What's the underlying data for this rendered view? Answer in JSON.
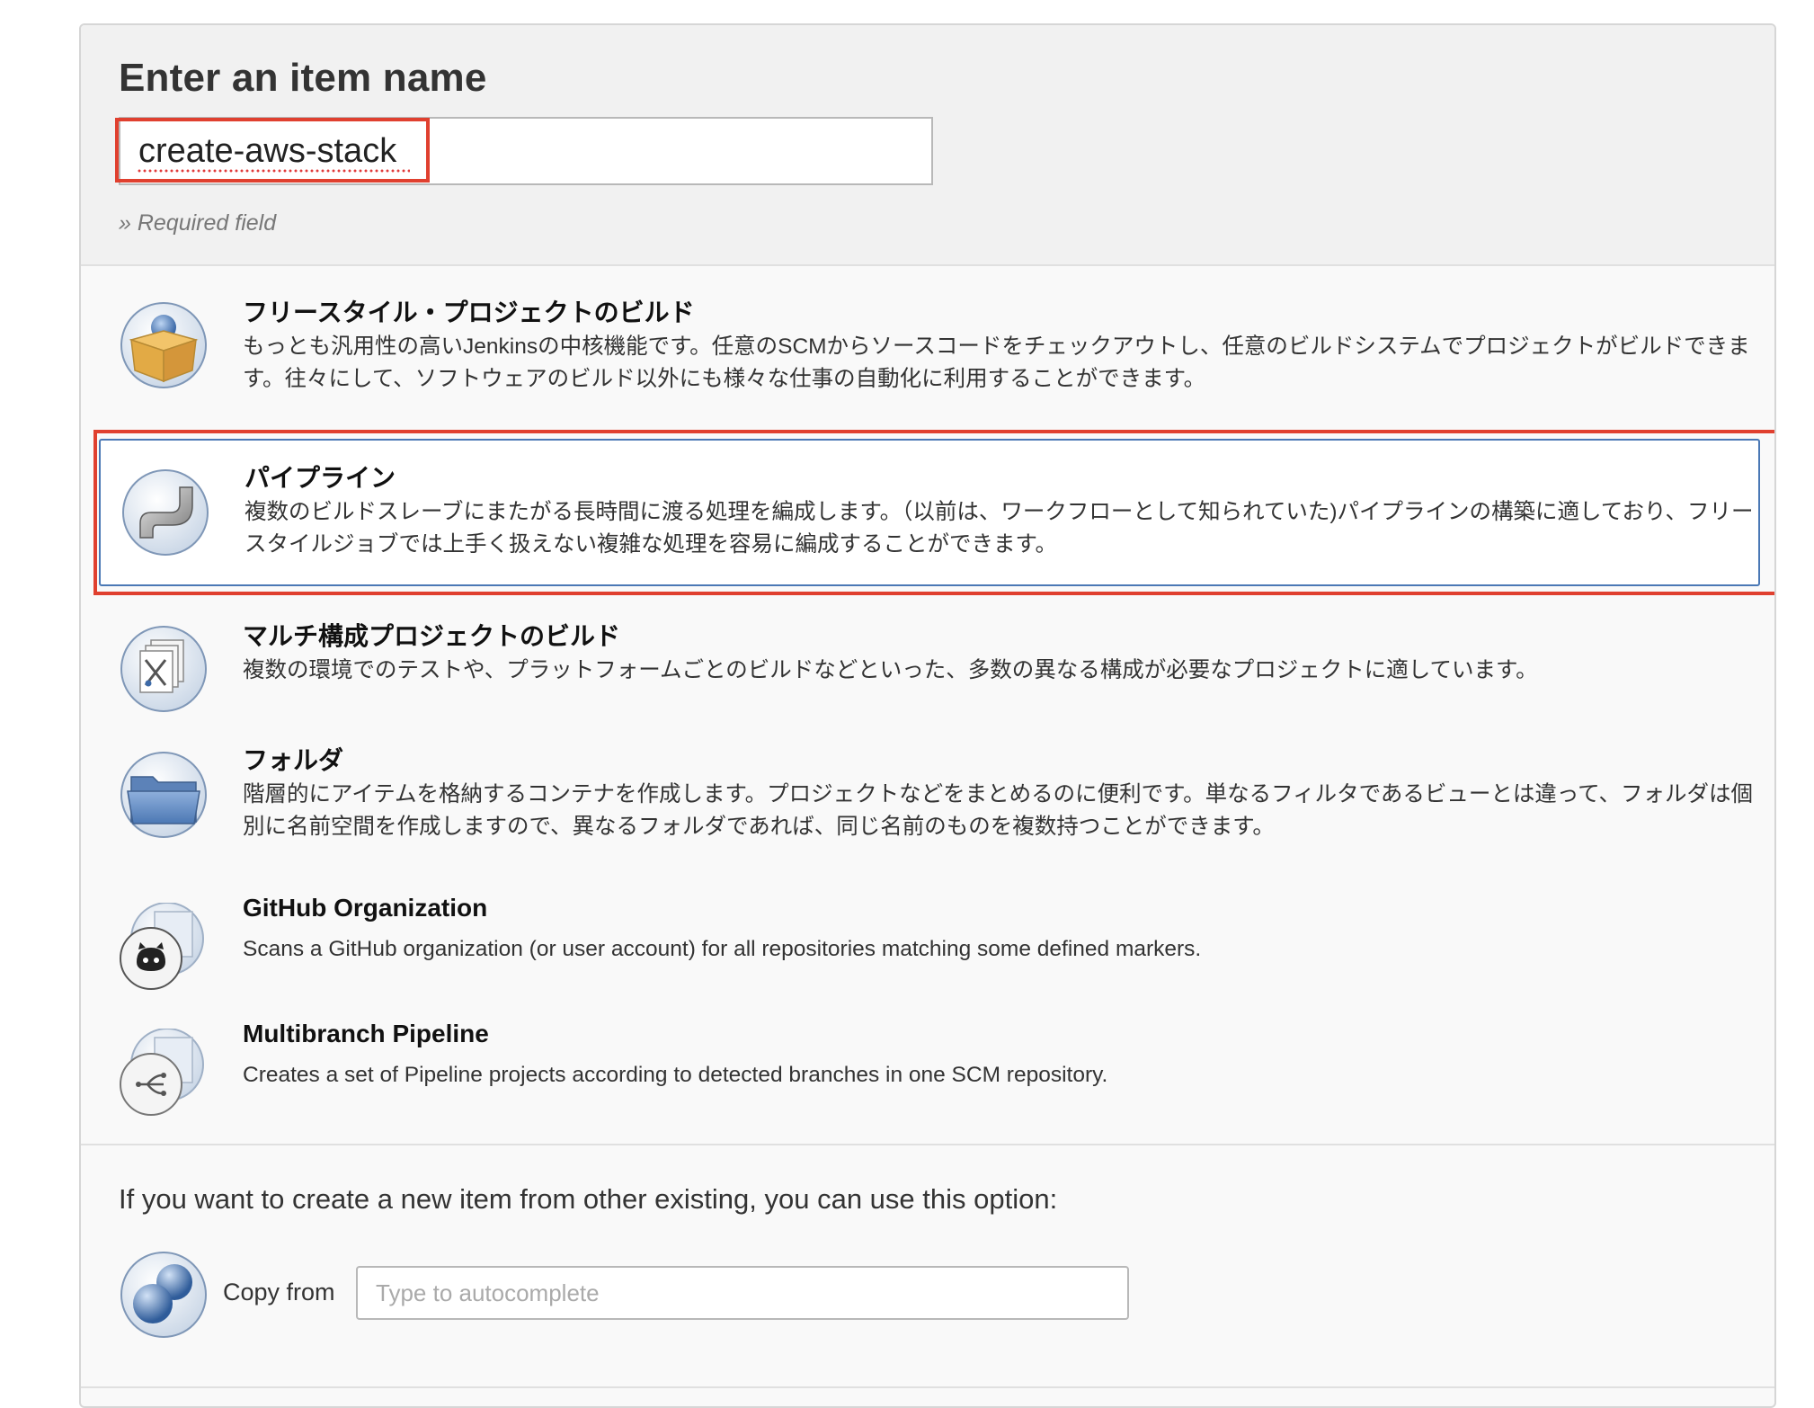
{
  "header": {
    "title": "Enter an item name",
    "name_value": "create-aws-stack",
    "required_note": "» Required field"
  },
  "items": [
    {
      "title": "フリースタイル・プロジェクトのビルド",
      "description": "もっとも汎用性の高いJenkinsの中核機能です。任意のSCMからソースコードをチェックアウトし、任意のビルドシステムでプロジェクトがビルドできます。往々にして、ソフトウェアのビルド以外にも様々な仕事の自動化に利用することができます。",
      "icon": "freestyle-box-icon"
    },
    {
      "title": "パイプライン",
      "description": "複数のビルドスレーブにまたがる長時間に渡る処理を編成します。（以前は、ワークフローとして知られていた)パイプラインの構築に適しており、フリースタイルジョブでは上手く扱えない複雑な処理を容易に編成することができます。",
      "icon": "pipeline-pipe-icon",
      "selected": true
    },
    {
      "title": "マルチ構成プロジェクトのビルド",
      "description": "複数の環境でのテストや、プラットフォームごとのビルドなどといった、多数の異なる構成が必要なプロジェクトに適しています。",
      "icon": "multi-config-icon"
    },
    {
      "title": "フォルダ",
      "description": "階層的にアイテムを格納するコンテナを作成します。プロジェクトなどをまとめるのに便利です。単なるフィルタであるビューとは違って、フォルダは個別に名前空間を作成しますので、異なるフォルダであれば、同じ名前のものを複数持つことができます。",
      "icon": "folder-icon"
    },
    {
      "title": "GitHub Organization",
      "description": "Scans a GitHub organization (or user account) for all repositories matching some defined markers.",
      "icon": "github-octocat-icon"
    },
    {
      "title": "Multibranch Pipeline",
      "description": "Creates a set of Pipeline projects according to detected branches in one SCM repository.",
      "icon": "multibranch-icon"
    }
  ],
  "copy": {
    "heading": "If you want to create a new item from other existing, you can use this option:",
    "label": "Copy from",
    "placeholder": "Type to autocomplete"
  },
  "colors": {
    "highlight": "#e0402f",
    "selected_border": "#4a78b5"
  }
}
